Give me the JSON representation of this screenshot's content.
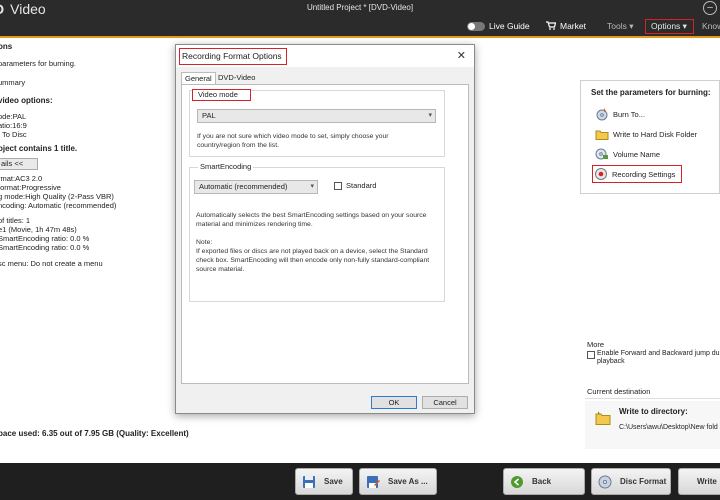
{
  "app": {
    "title": "Video",
    "logo_text": "D",
    "project_title": "Untitled Project * [DVD-Video]",
    "nav": {
      "live_guide": "Live Guide",
      "market": "Market",
      "tools": "Tools ▾",
      "options": "Options ▾",
      "know": "Know"
    },
    "accent_color": "#e69a1c",
    "highlight_color": "#d8222a"
  },
  "left_panel": {
    "lines": [
      "ons",
      "parameters for burning.",
      "ummary",
      "video options:",
      "ode:PAL",
      "atio:16:9",
      "t To Disc",
      "oject contains 1 title.",
      "ails <<",
      "rmat:AC3 2.0",
      "format:Progressive",
      "g mode:High Quality (2-Pass VBR)",
      "ncoding: Automatic (recommended)",
      "of titles: 1",
      "e1 (Movie, 1h 47m 48s)",
      "SmartEncoding ratio: 0.0 %",
      "SmartEncoding ratio: 0.0 %",
      "sc menu: Do not create a menu",
      "pace used: 6.35 out of 7.95 GB (Quality: Excellent)"
    ]
  },
  "right_panel": {
    "heading": "Set the parameters for burning:",
    "items": [
      "Burn To...",
      "Write to Hard Disk Folder",
      "Volume Name",
      "Recording Settings"
    ],
    "more_label": "More",
    "enable_line1": "Enable Forward and Backward jump duri",
    "enable_line2": "playback",
    "current_destination_label": "Current destination",
    "write_to_directory": "Write to directory:",
    "directory_path": "C:\\Users\\awu\\Desktop\\New fold"
  },
  "bottom_bar": {
    "save": "Save",
    "save_as": "Save As ...",
    "back": "Back",
    "disc_format": "Disc Format",
    "write": "Write"
  },
  "dialog": {
    "title": "Recording Format Options",
    "close_glyph": "✕",
    "tabs": [
      "General",
      "DVD-Video"
    ],
    "video_mode": {
      "legend": "Video mode",
      "selected": "PAL",
      "hint_line1": "If you are not sure which video mode to set, simply choose your",
      "hint_line2": "country/region from the list."
    },
    "smart_encoding": {
      "legend": "SmartEncoding",
      "selected": "Automatic (recommended)",
      "standard_label": "Standard",
      "desc_line1": "Automatically selects the best SmartEncoding settings based on your source",
      "desc_line2": "material and minimizes rendering time.",
      "note_label": "Note:",
      "note_line1": "If exported files or discs are not played back on a device, select the Standard",
      "note_line2": "check box. SmartEncoding will then encode only non-fully standard-compliant",
      "note_line3": "source material."
    },
    "ok": "OK",
    "cancel": "Cancel"
  }
}
